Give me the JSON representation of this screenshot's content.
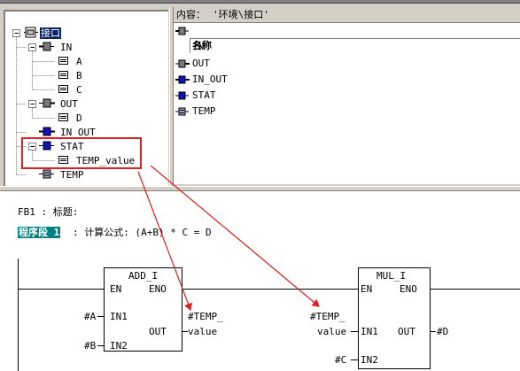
{
  "content_bar": {
    "label": "内容：",
    "path": "'环境\\接口'"
  },
  "tree": {
    "root": "接口",
    "in": "IN",
    "in_children": [
      "A",
      "B",
      "C"
    ],
    "out": "OUT",
    "out_children": [
      "D"
    ],
    "in_out": "IN_OUT",
    "stat": "STAT",
    "stat_children": [
      "TEMP_value"
    ],
    "temp": "TEMP"
  },
  "list": {
    "header": "名称",
    "items": [
      "IN",
      "OUT",
      "IN_OUT",
      "STAT",
      "TEMP"
    ]
  },
  "editor": {
    "block_title": "FB1 : 标题:",
    "network_label": "程序段 1",
    "network_comment": ": 计算公式: (A+B) * C = D"
  },
  "blocks": {
    "add": {
      "name": "ADD_I",
      "en": "EN",
      "eno": "ENO",
      "in1": "IN1",
      "in2": "IN2",
      "out": "OUT"
    },
    "mul": {
      "name": "MUL_I",
      "en": "EN",
      "eno": "ENO",
      "in1": "IN1",
      "in2": "IN2",
      "out": "OUT"
    }
  },
  "operands": {
    "add_in1": "#A",
    "add_in2": "#B",
    "add_out_1": "#TEMP_",
    "add_out_2": "value",
    "mul_in1_1": "#TEMP_",
    "mul_in1_2": "value",
    "mul_in2": "#C",
    "mul_out": "#D"
  },
  "colors": {
    "annotation": "#e02020",
    "selection": "#0a246a",
    "network_tag": "#008080",
    "in_icon": "#7a7a7a",
    "stat_icon": "#1010c0"
  }
}
